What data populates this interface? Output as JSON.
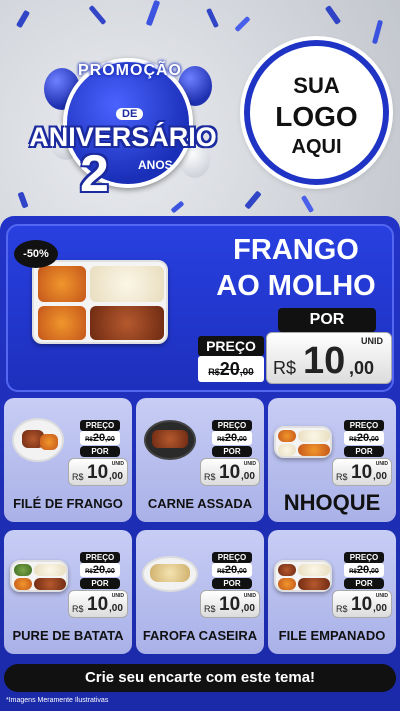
{
  "header": {
    "promo_top": "PROMOÇÃO",
    "promo_de": "DE",
    "promo_main": "ANIVERSÁRIO",
    "promo_number": "2",
    "promo_anos": "ANOS",
    "logo_line1": "SUA",
    "logo_line2": "LOGO",
    "logo_line3": "AQUI"
  },
  "hero": {
    "discount": "-50%",
    "name_line1": "FRANGO",
    "name_line2": "AO MOLHO",
    "preco_label": "PREÇO",
    "old_currency": "R$",
    "old_price": "20",
    "old_cents": ",00",
    "por_label": "POR",
    "unid_label": "UNID",
    "currency": "R$",
    "price": "10",
    "cents": ",00"
  },
  "cards": [
    {
      "name": "FILÉ DE FRANGO",
      "preco_label": "PREÇO",
      "old_currency": "R$",
      "old_price": "20",
      "old_cents": ",00",
      "por_label": "POR",
      "currency": "R$",
      "price": "10",
      "cents": ",00",
      "unid_label": "UNID"
    },
    {
      "name": "CARNE ASSADA",
      "preco_label": "PREÇO",
      "old_currency": "R$",
      "old_price": "20",
      "old_cents": ",00",
      "por_label": "POR",
      "currency": "R$",
      "price": "10",
      "cents": ",00",
      "unid_label": "UNID"
    },
    {
      "name": "NHOQUE",
      "preco_label": "PREÇO",
      "old_currency": "R$",
      "old_price": "20",
      "old_cents": ",00",
      "por_label": "POR",
      "currency": "R$",
      "price": "10",
      "cents": ",00",
      "unid_label": "UNID"
    },
    {
      "name": "PURE DE BATATA",
      "preco_label": "PREÇO",
      "old_currency": "R$",
      "old_price": "20",
      "old_cents": ",00",
      "por_label": "POR",
      "currency": "R$",
      "price": "10",
      "cents": ",00",
      "unid_label": "UNID"
    },
    {
      "name": "FAROFA CASEIRA",
      "preco_label": "PREÇO",
      "old_currency": "R$",
      "old_price": "20",
      "old_cents": ",00",
      "por_label": "POR",
      "currency": "R$",
      "price": "10",
      "cents": ",00",
      "unid_label": "UNID"
    },
    {
      "name": "FILE EMPANADO",
      "preco_label": "PREÇO",
      "old_currency": "R$",
      "old_price": "20",
      "old_cents": ",00",
      "por_label": "POR",
      "currency": "R$",
      "price": "10",
      "cents": ",00",
      "unid_label": "UNID"
    }
  ],
  "cta": "Crie seu encarte com este tema!",
  "footnote": "*Imagens Meramente Ilustrativas",
  "colors": {
    "primary_blue": "#2234c8",
    "card_bg": "#b9c0ee",
    "dark": "#111111",
    "white": "#ffffff"
  }
}
